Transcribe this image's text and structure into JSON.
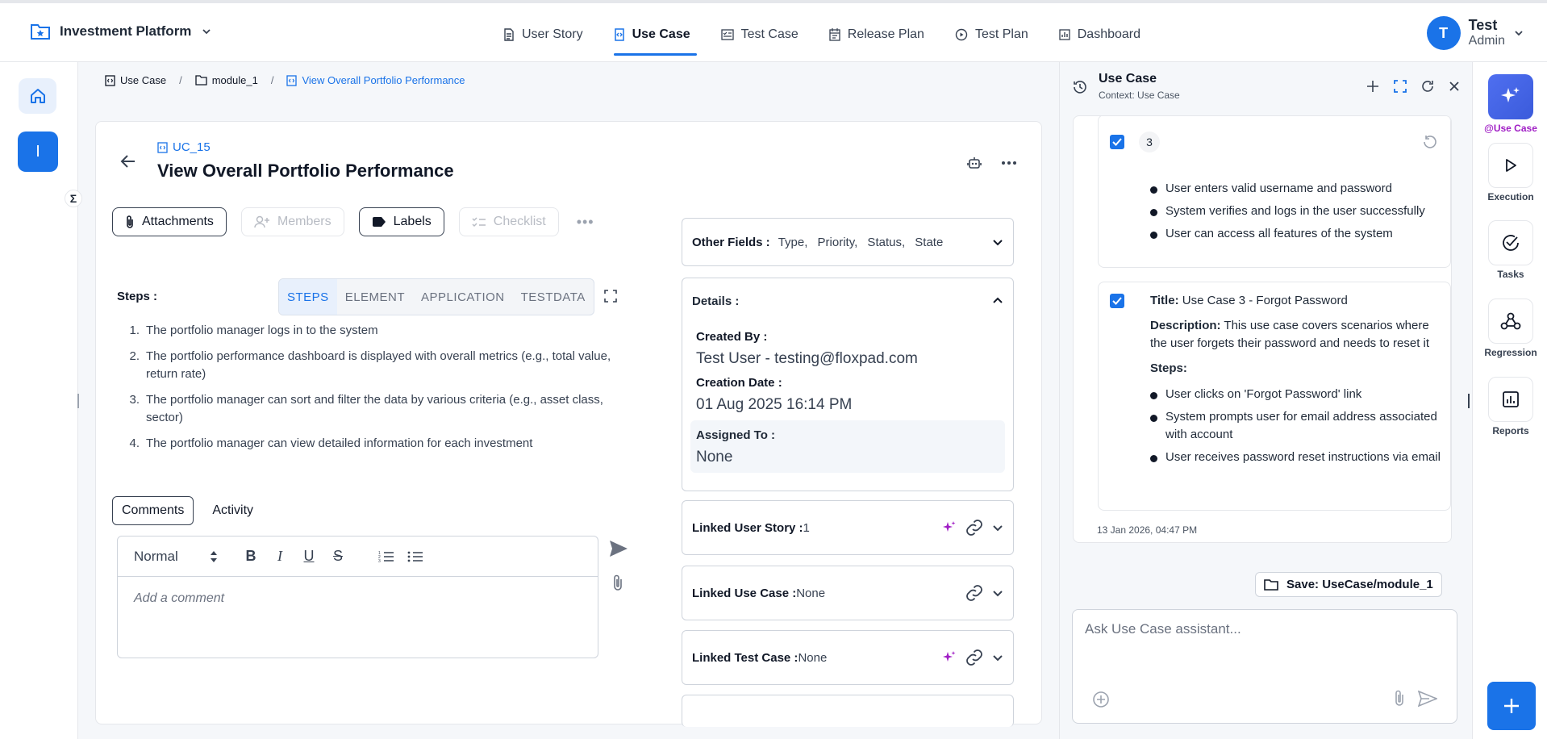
{
  "app": {
    "project_name": "Investment Platform",
    "nav": [
      {
        "label": "User Story",
        "icon": "document-icon"
      },
      {
        "label": "Use Case",
        "icon": "code-file-icon",
        "active": true
      },
      {
        "label": "Test Case",
        "icon": "checklist-icon"
      },
      {
        "label": "Release Plan",
        "icon": "calendar-icon"
      },
      {
        "label": "Test Plan",
        "icon": "play-circle-icon"
      },
      {
        "label": "Dashboard",
        "icon": "chart-icon"
      }
    ],
    "user": {
      "initial": "T",
      "name": "Test",
      "role": "Admin"
    },
    "accent": "#1a73e8"
  },
  "sidebar": {
    "workspace_initial": "I",
    "toggle_symbol": "Σ"
  },
  "breadcrumb": {
    "root": "Use Case",
    "folder": "module_1",
    "current": "View Overall Portfolio Performance",
    "separator": "/"
  },
  "usecase": {
    "id": "UC_15",
    "title": "View Overall Portfolio Performance",
    "chips": {
      "attachments": "Attachments",
      "members": "Members",
      "labels": "Labels",
      "checklist": "Checklist"
    },
    "steps_label": "Steps :",
    "step_tabs": [
      "STEPS",
      "ELEMENT",
      "APPLICATION",
      "TESTDATA"
    ],
    "steps": [
      {
        "n": "1.",
        "text": "The portfolio manager logs in to the system"
      },
      {
        "n": "2.",
        "text": "The portfolio performance dashboard is displayed with overall metrics (e.g., total value, return rate)"
      },
      {
        "n": "3.",
        "text": "The portfolio manager can sort and filter the data by various criteria (e.g., asset class, sector)"
      },
      {
        "n": "4.",
        "text": "The portfolio manager can view detailed information for each investment"
      }
    ],
    "comment_tabs": {
      "comments": "Comments",
      "activity": "Activity"
    },
    "editor": {
      "format": "Normal",
      "placeholder": "Add a comment"
    }
  },
  "fields": {
    "other_label": "Other Fields :",
    "other_values": "Type,  Priority,  Status,  State",
    "details_label": "Details :",
    "created_by_label": "Created By :",
    "created_by": "Test User - testing@floxpad.com",
    "creation_date_label": "Creation Date :",
    "creation_date": "01 Aug 2025 16:14 PM",
    "assigned_to_label": "Assigned To :",
    "assigned_to": "None",
    "linked_user_story_label": "Linked User Story :",
    "linked_user_story": "1",
    "linked_use_case_label": "Linked Use Case :",
    "linked_use_case": "None",
    "linked_test_case_label": "Linked Test Case :",
    "linked_test_case": "None"
  },
  "assistant": {
    "title": "Use Case",
    "context": "Context: Use Case",
    "item_a": {
      "number": "3",
      "bullets": [
        "User enters valid username and password",
        "System verifies and logs in the user successfully",
        "User can access all features of the system"
      ]
    },
    "item_b": {
      "title_label": "Title:",
      "title": "Use Case 3 - Forgot Password",
      "description_label": "Description:",
      "description": "This use case covers scenarios where the user forgets their password and needs to reset it",
      "steps_label": "Steps:",
      "steps": [
        "User clicks on 'Forgot Password' link",
        "System prompts user for email address associated with account",
        "User receives password reset instructions via email"
      ]
    },
    "timestamp": "13 Jan 2026, 04:47 PM",
    "save_label": "Save: UseCase/module_1",
    "input_placeholder": "Ask Use Case assistant..."
  },
  "rail": {
    "items": [
      {
        "label": "@Use Case",
        "icon": "sparkle-icon"
      },
      {
        "label": "Execution",
        "icon": "play-icon"
      },
      {
        "label": "Tasks",
        "icon": "check-circle-icon"
      },
      {
        "label": "Regression",
        "icon": "webhook-icon"
      },
      {
        "label": "Reports",
        "icon": "bar-chart-icon"
      }
    ],
    "fab_symbol": "+"
  }
}
